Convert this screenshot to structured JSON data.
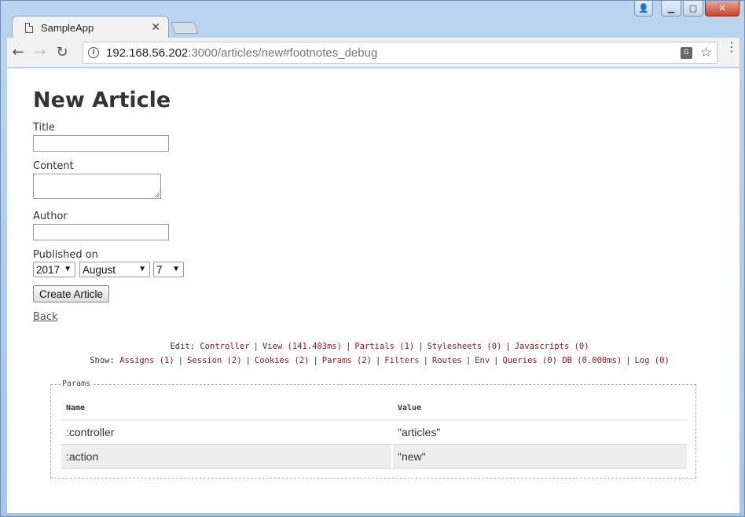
{
  "window": {
    "controls": {
      "user": "👤",
      "minimize": "▁",
      "maximize": "▢",
      "close": "✕"
    }
  },
  "tab": {
    "title": "SampleApp",
    "close": "✕"
  },
  "toolbar": {
    "back": "←",
    "forward": "→",
    "reload": "↻",
    "url_host": "192.168.56.202",
    "url_rest": ":3000/articles/new#footnotes_debug",
    "info": "i",
    "translate": "G",
    "star": "☆",
    "menu": "⋮"
  },
  "form": {
    "heading": "New Article",
    "title_label": "Title",
    "content_label": "Content",
    "author_label": "Author",
    "published_label": "Published on",
    "year": "2017",
    "month": "August",
    "day": "7",
    "submit": "Create Article",
    "back": "Back"
  },
  "debug": {
    "edit_label": "Edit:",
    "edit_links": [
      "Controller",
      "View (141.403ms)",
      "Partials (1)",
      "Stylesheets (0)",
      "Javascripts (0)"
    ],
    "show_label": "Show:",
    "show_links": [
      "Assigns (1)",
      "Session (2)",
      "Cookies (2)",
      "Params (2)",
      "Filters",
      "Routes",
      "Env",
      "Queries (0) DB (0.000ms)",
      "Log (0)"
    ]
  },
  "params": {
    "legend": "Params",
    "headers": {
      "name": "Name",
      "value": "Value"
    },
    "rows": [
      {
        "name": ":controller",
        "value": "\"articles\""
      },
      {
        "name": ":action",
        "value": "\"new\""
      }
    ]
  }
}
